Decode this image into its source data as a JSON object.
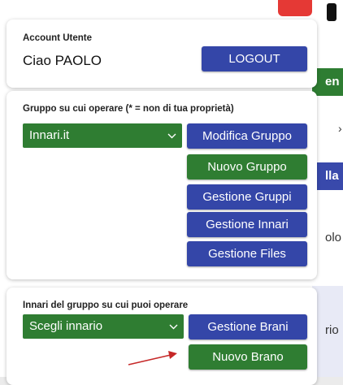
{
  "background": {
    "green_band_text": "en",
    "arrow_glyph": "›",
    "blue_band_text": "lla",
    "text_1": "olo",
    "text_2": "rio"
  },
  "account": {
    "heading": "Account Utente",
    "greeting": "Ciao PAOLO",
    "logout_label": "LOGOUT"
  },
  "group": {
    "heading": "Gruppo su cui operare (* = non di tua proprietà)",
    "selected": "Innari.it",
    "buttons": {
      "edit": "Modifica Gruppo",
      "new": "Nuovo Gruppo",
      "manage_groups": "Gestione Gruppi",
      "manage_hymnals": "Gestione Innari",
      "manage_files": "Gestione Files"
    }
  },
  "hymnal": {
    "heading": "Innari del gruppo su cui puoi operare",
    "selected": "Scegli innario",
    "buttons": {
      "manage_songs": "Gestione Brani",
      "new_song": "Nuovo Brano"
    }
  },
  "colors": {
    "blue_button": "#3446a8",
    "green_button": "#2f7d32",
    "arrow": "#c62828",
    "logout_tab": "#e53935"
  }
}
